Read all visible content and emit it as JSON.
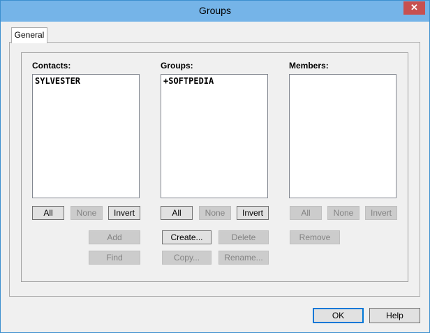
{
  "window": {
    "title": "Groups",
    "close_glyph": "✕"
  },
  "tabs": [
    {
      "label": "General"
    }
  ],
  "contacts": {
    "label": "Contacts:",
    "items": [
      "SYLVESTER"
    ],
    "buttons": {
      "all": "All",
      "none": "None",
      "invert": "Invert",
      "add": "Add",
      "find": "Find"
    }
  },
  "groups": {
    "label": "Groups:",
    "items": [
      "+SOFTPEDIA"
    ],
    "buttons": {
      "all": "All",
      "none": "None",
      "invert": "Invert",
      "create": "Create...",
      "delete": "Delete",
      "copy": "Copy...",
      "rename": "Rename..."
    }
  },
  "members": {
    "label": "Members:",
    "items": [],
    "buttons": {
      "all": "All",
      "none": "None",
      "invert": "Invert",
      "remove": "Remove"
    }
  },
  "footer": {
    "ok": "OK",
    "help": "Help"
  }
}
